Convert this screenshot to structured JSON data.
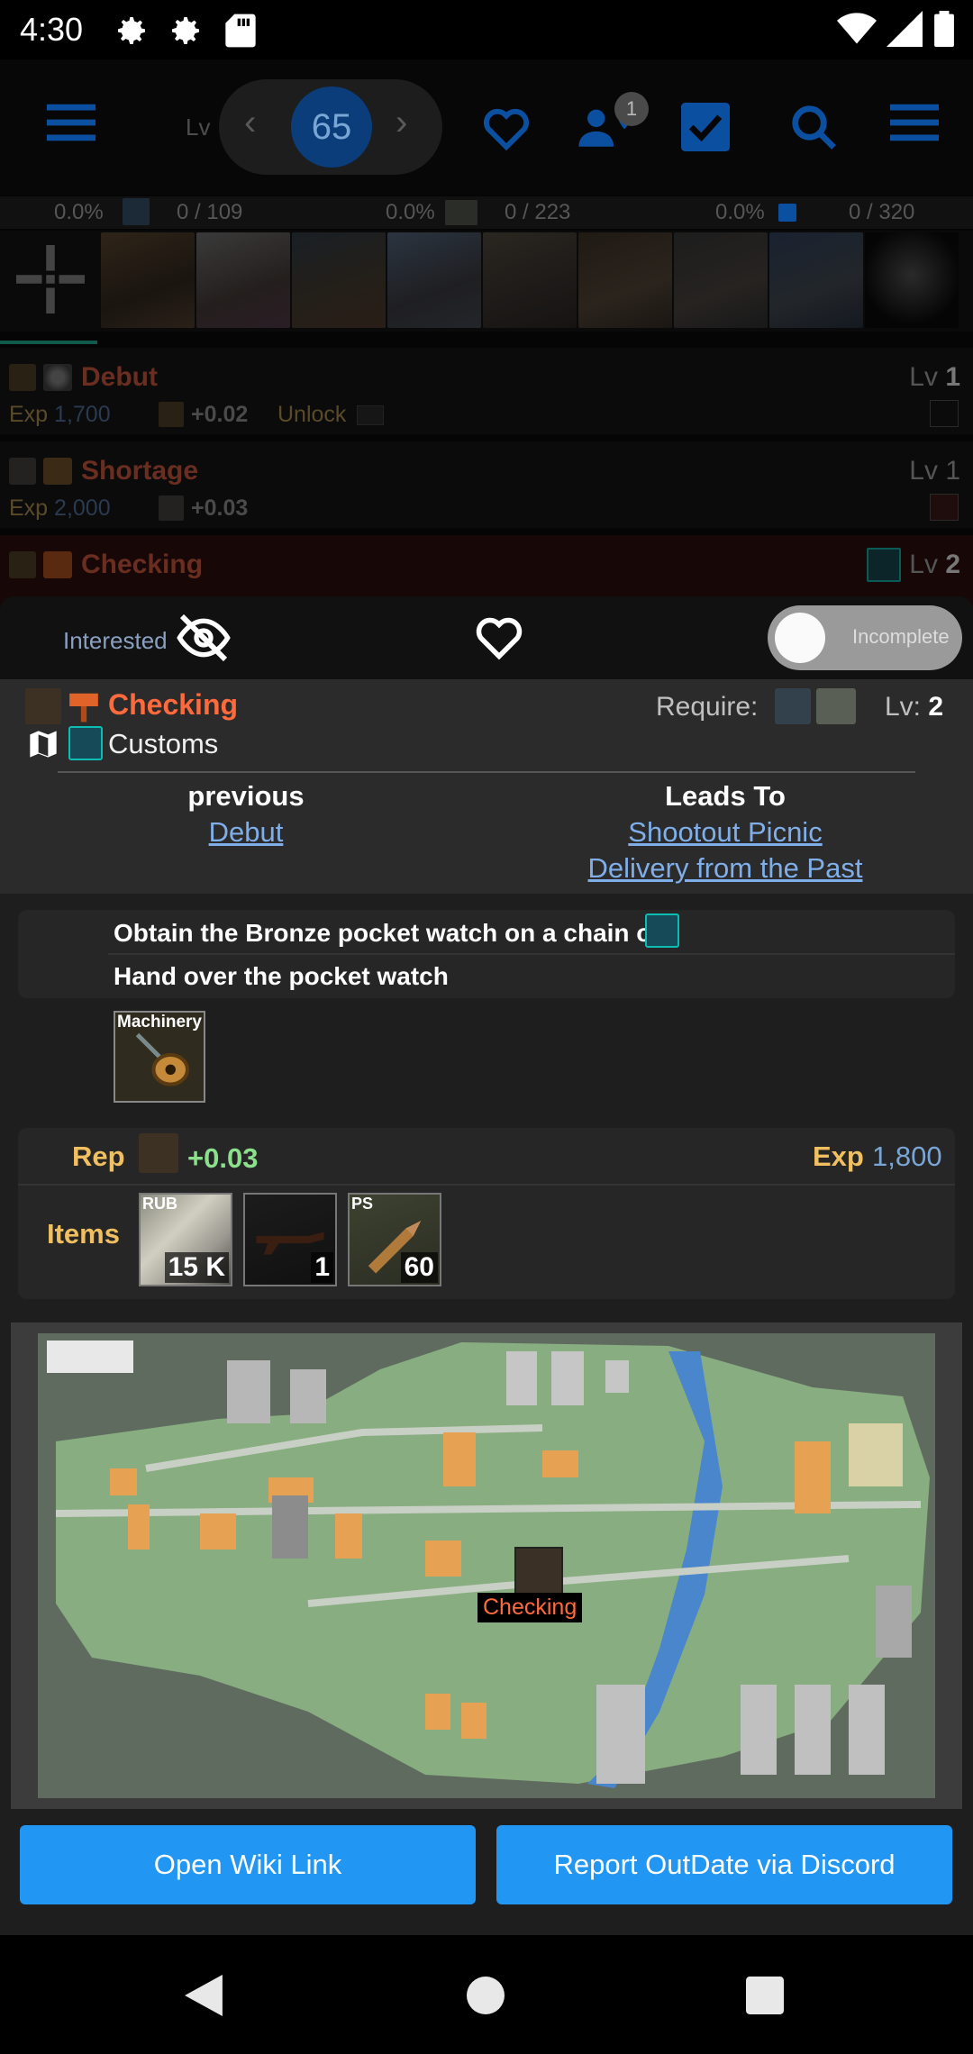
{
  "status_bar": {
    "time": "4:30"
  },
  "top_nav": {
    "level_label": "Lv",
    "level": "65",
    "notification_count": "1"
  },
  "stats": [
    {
      "percent": "0.0%",
      "count": "0 / 109"
    },
    {
      "percent": "0.0%",
      "count": "0 / 223"
    },
    {
      "percent": "0.0%",
      "count": "0 / 320"
    }
  ],
  "quest_list": [
    {
      "name": "Debut",
      "level_label": "Lv",
      "level": "1",
      "exp_label": "Exp",
      "exp": "1,700",
      "rep": "+0.02",
      "unlock": "Unlock"
    },
    {
      "name": "Shortage",
      "level_label": "Lv",
      "level": "1",
      "exp_label": "Exp",
      "exp": "2,000",
      "rep": "+0.03"
    },
    {
      "name": "Checking",
      "level_label": "Lv",
      "level": "2"
    }
  ],
  "sheet": {
    "interested_label": "Interested",
    "toggle_label": "Incomplete",
    "quest_name": "Checking",
    "location": "Customs",
    "require_label": "Require:",
    "level_label": "Lv:",
    "level": "2",
    "previous_title": "previous",
    "previous_link": "Debut",
    "leads_title": "Leads To",
    "leads_links": [
      "Shootout Picnic",
      "Delivery from the Past"
    ],
    "objectives": [
      "Obtain the Bronze pocket watch on a chain on",
      "Hand over the pocket watch"
    ],
    "required_item_tag": "Machinery",
    "rewards": {
      "rep_label": "Rep",
      "rep_value": "+0.03",
      "exp_label": "Exp",
      "exp_value": "1,800",
      "items_label": "Items",
      "items": [
        {
          "tag": "RUB",
          "qty": "15 K"
        },
        {
          "tag": "",
          "qty": "1"
        },
        {
          "tag": "PS",
          "qty": "60"
        }
      ]
    },
    "map_marker_label": "Checking",
    "wiki_button": "Open Wiki Link",
    "report_button": "Report OutDate via Discord"
  },
  "colors": {
    "accent_blue": "#2196f3",
    "quest_orange": "#ff6a3d",
    "reward_gold": "#f0c060",
    "rep_green": "#8be08b",
    "link_blue": "#7faee8"
  }
}
